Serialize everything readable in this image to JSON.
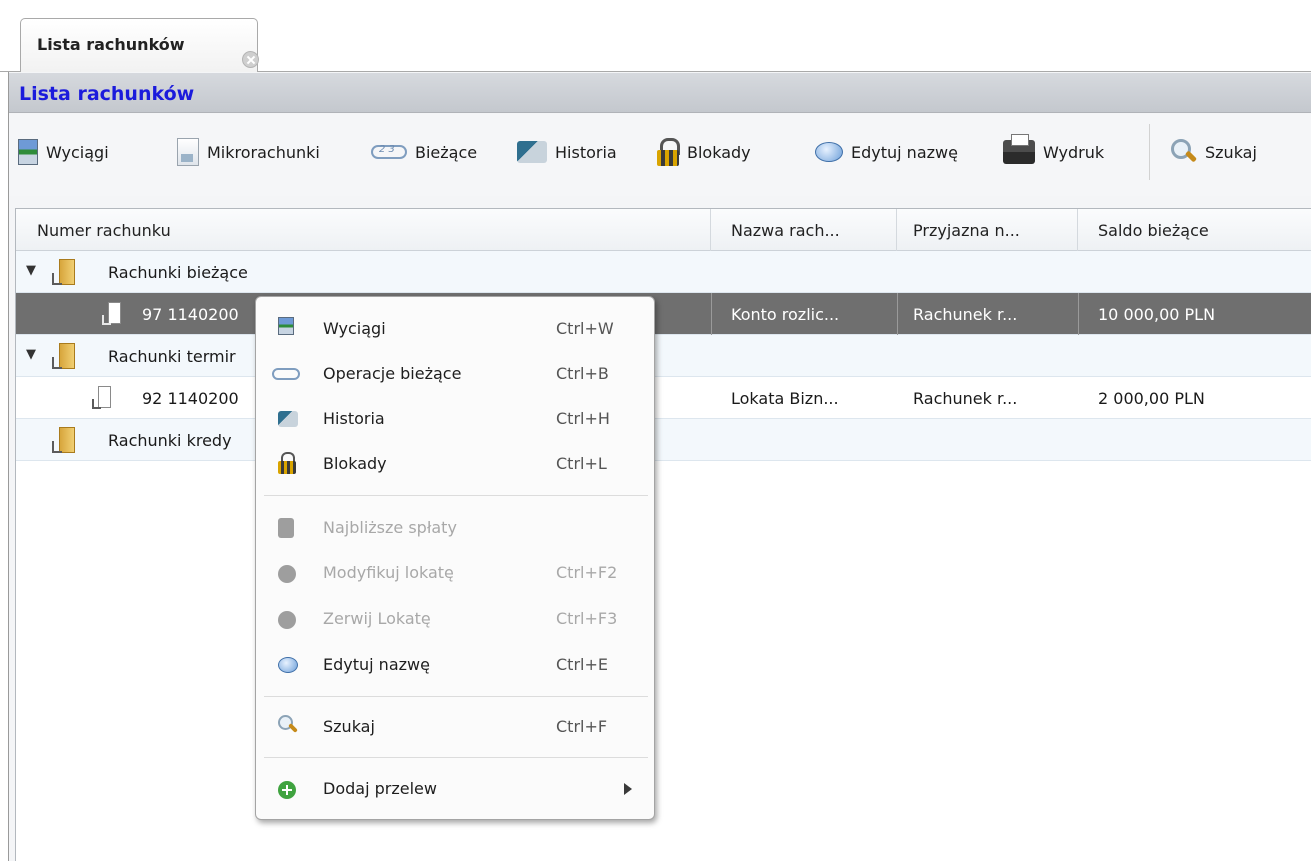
{
  "tab": {
    "label": "Lista rachunków"
  },
  "panel": {
    "title": "Lista rachunków"
  },
  "toolbar": {
    "items": [
      {
        "label": "Wyciągi",
        "icon": "statement-icon"
      },
      {
        "label": "Mikrorachunki",
        "icon": "micro-accounts-icon"
      },
      {
        "label": "Bieżące",
        "icon": "current-operations-icon"
      },
      {
        "label": "Historia",
        "icon": "history-icon"
      },
      {
        "label": "Blokady",
        "icon": "lock-icon"
      },
      {
        "label": "Edytuj nazwę",
        "icon": "speech-bubble-icon"
      },
      {
        "label": "Wydruk",
        "icon": "printer-icon"
      },
      {
        "label": "Szukaj",
        "icon": "search-icon"
      }
    ]
  },
  "grid": {
    "columns": [
      "Numer rachunku",
      "Nazwa rach...",
      "Przyjazna n...",
      "Saldo bieżące"
    ],
    "rows": [
      {
        "type": "group",
        "label": "Rachunki bieżące",
        "expanded": true
      },
      {
        "type": "account",
        "number": "97 1140200",
        "name": "Konto rozlic...",
        "friendly": "Rachunek r...",
        "balance": "10 000,00 PLN",
        "selected": true
      },
      {
        "type": "group",
        "label": "Rachunki termir",
        "expanded": true
      },
      {
        "type": "account",
        "number": "92 1140200",
        "name": "Lokata Bizn...",
        "friendly": "Rachunek r...",
        "balance": "2 000,00 PLN",
        "selected": false
      },
      {
        "type": "group",
        "label": "Rachunki kredy",
        "expanded": false
      }
    ]
  },
  "context_menu": {
    "items": [
      {
        "label": "Wyciągi",
        "shortcut": "Ctrl+W",
        "enabled": true,
        "icon": "statement-icon"
      },
      {
        "label": "Operacje bieżące",
        "shortcut": "Ctrl+B",
        "enabled": true,
        "icon": "current-operations-icon"
      },
      {
        "label": "Historia",
        "shortcut": "Ctrl+H",
        "enabled": true,
        "icon": "history-icon"
      },
      {
        "label": "Blokady",
        "shortcut": "Ctrl+L",
        "enabled": true,
        "icon": "lock-icon"
      },
      {
        "label": "Najbliższe spłaty",
        "shortcut": "",
        "enabled": false,
        "icon": "repayments-icon"
      },
      {
        "label": "Modyfikuj lokatę",
        "shortcut": "Ctrl+F2",
        "enabled": false,
        "icon": "modify-deposit-icon"
      },
      {
        "label": "Zerwij Lokatę",
        "shortcut": "Ctrl+F3",
        "enabled": false,
        "icon": "break-deposit-icon"
      },
      {
        "label": "Edytuj nazwę",
        "shortcut": "Ctrl+E",
        "enabled": true,
        "icon": "speech-bubble-icon"
      },
      {
        "label": "Szukaj",
        "shortcut": "Ctrl+F",
        "enabled": true,
        "icon": "search-icon"
      },
      {
        "label": "Dodaj przelew",
        "shortcut": "",
        "enabled": true,
        "icon": "add-transfer-icon",
        "submenu": true
      }
    ]
  },
  "colors": {
    "title_text": "#1b1bdc",
    "selected_row": "#6f6f6f",
    "disabled_text": "#a8a8a8"
  }
}
